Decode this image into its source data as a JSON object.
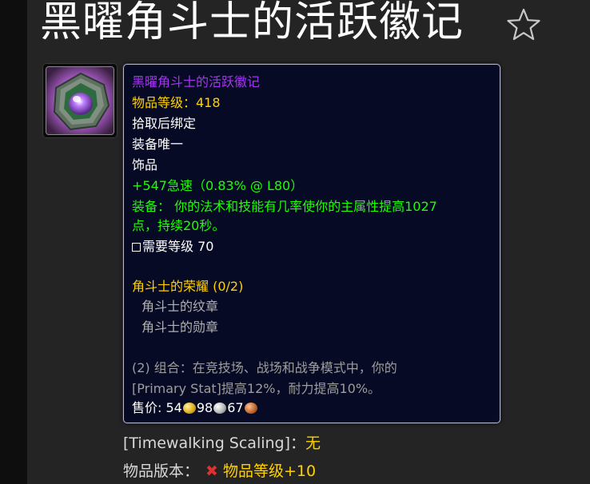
{
  "page": {
    "title": "黑曜角斗士的活跃徽记"
  },
  "item": {
    "name": "黑曜角斗士的活跃徽记",
    "item_level": "物品等级：418",
    "bind": "拾取后绑定",
    "unique": "装备唯一",
    "slot": "饰品",
    "stat": "+547急速（0.83% @ L80）",
    "equip_line1": "装备： 你的法术和技能有几率使你的主属性提高1027",
    "equip_line2": "点，持续20秒。",
    "required_level": "需要等级 70",
    "set_name": "角斗士的荣耀 (0/2)",
    "set_items": [
      "角斗士的纹章",
      "角斗士的勋章"
    ],
    "set_bonus_line1": "(2) 组合：在竞技场、战场和战争模式中，你的",
    "set_bonus_line2": "[Primary Stat]提高12%，耐力提高10%。",
    "sell_label": "售价:",
    "sell_gold": "54",
    "sell_silver": "98",
    "sell_copper": "67"
  },
  "info": {
    "scaling_label": "[Timewalking Scaling]：",
    "scaling_value": "无",
    "version_label": "物品版本：",
    "version_value": "物品等级+10"
  },
  "colors": {
    "epic_purple": "#a335ee",
    "gold": "#ffd100",
    "green": "#1eff00",
    "tooltip_bg": "#070a24"
  },
  "icons": {
    "favorite": "star-outline-icon",
    "item": "purple-gem-trinket-icon",
    "version_marker": "red-x-icon"
  }
}
